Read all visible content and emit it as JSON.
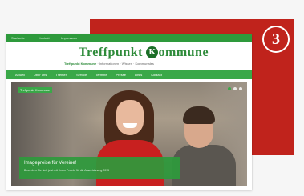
{
  "badge": {
    "number": "3"
  },
  "site": {
    "topbar": {
      "links": [
        "Startseite",
        "Kontakt",
        "Impressum"
      ]
    },
    "logo": {
      "text_before": "Treffpunkt",
      "k_letter": "K",
      "text_after": "ommune"
    },
    "tagline": {
      "strong": "Treffpunkt Kommune",
      "rest": " · Informationen · Wissen · Kommunales"
    },
    "nav": {
      "items": [
        "Aktuell",
        "Über uns",
        "Themen",
        "Service",
        "Termine",
        "Presse",
        "Links",
        "Kontakt"
      ]
    },
    "hero": {
      "label": "Treffpunkt Kommune",
      "caption_title": "Imagepreise für Vereine!",
      "caption_text": "Bewerben Sie sich jetzt mit Ihrem Projekt für die Auszeichnung 2015"
    }
  },
  "colors": {
    "accent_red": "#c0231c",
    "brand_green": "#3aa848",
    "dark_green": "#2e9a3c"
  }
}
